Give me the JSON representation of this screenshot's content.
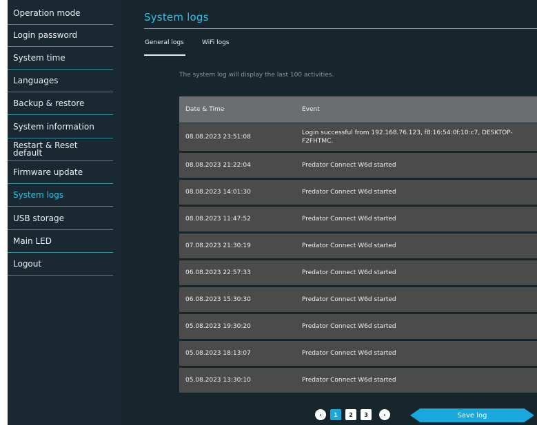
{
  "sidebar": {
    "items": [
      {
        "label": "Operation mode",
        "active": false
      },
      {
        "label": "Login password",
        "active": false
      },
      {
        "label": "System time",
        "active": false
      },
      {
        "label": "Languages",
        "active": false
      },
      {
        "label": "Backup & restore",
        "active": false
      },
      {
        "label": "System information",
        "active": false
      },
      {
        "label": "Restart & Reset default",
        "active": false
      },
      {
        "label": "Firmware update",
        "active": false
      },
      {
        "label": "System logs",
        "active": true
      },
      {
        "label": "USB storage",
        "active": false
      },
      {
        "label": "Main LED",
        "active": false
      },
      {
        "label": "Logout",
        "active": false
      }
    ]
  },
  "main": {
    "title": "System logs",
    "tabs": [
      {
        "label": "General logs",
        "active": true
      },
      {
        "label": "WiFi logs",
        "active": false
      }
    ],
    "info": "The system log will display the last 100 activities.",
    "table": {
      "headers": [
        "Date & Time",
        "Event"
      ],
      "rows": [
        {
          "date": "08.08.2023 23:51:08",
          "event": "Login successful from 192.168.76.123, f8:16:54:0f:10:c7, DESKTOP-F2FHTMC."
        },
        {
          "date": "08.08.2023 21:22:04",
          "event": "Predator Connect W6d started"
        },
        {
          "date": "08.08.2023 14:01:30",
          "event": "Predator Connect W6d started"
        },
        {
          "date": "08.08.2023 11:47:52",
          "event": "Predator Connect W6d started"
        },
        {
          "date": "07.08.2023 21:30:19",
          "event": "Predator Connect W6d started"
        },
        {
          "date": "06.08.2023 22:57:33",
          "event": "Predator Connect W6d started"
        },
        {
          "date": "06.08.2023 15:30:30",
          "event": "Predator Connect W6d started"
        },
        {
          "date": "05.08.2023 19:30:20",
          "event": "Predator Connect W6d started"
        },
        {
          "date": "05.08.2023 18:13:07",
          "event": "Predator Connect W6d started"
        },
        {
          "date": "05.08.2023 13:30:10",
          "event": "Predator Connect W6d started"
        }
      ]
    },
    "pagination": {
      "prev": "‹",
      "pages": [
        "1",
        "2",
        "3"
      ],
      "current": "1",
      "next": "›"
    },
    "save_label": "Save log"
  },
  "colors": {
    "accent": "#2ec4e6",
    "button": "#1aa7dc",
    "background": "#17252d",
    "row": "#4b4b4b",
    "header": "#6b6e70"
  }
}
